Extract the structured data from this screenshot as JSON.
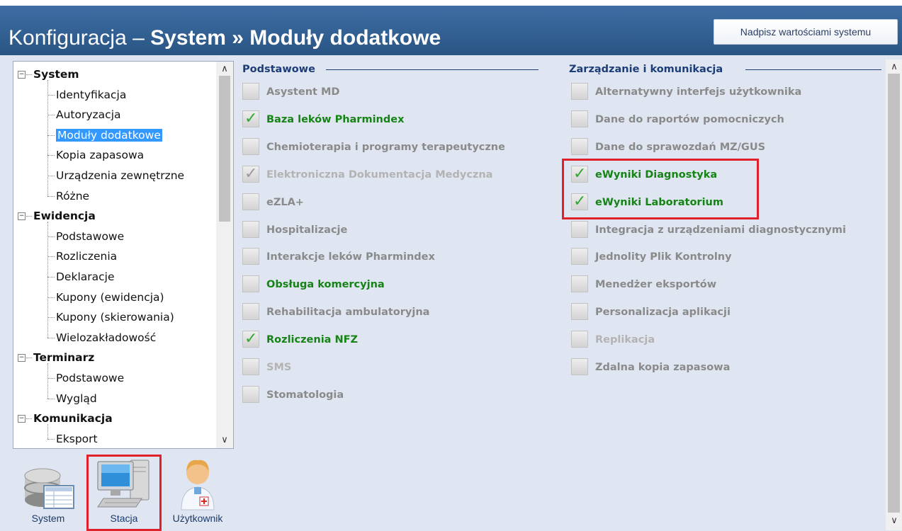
{
  "header": {
    "title_prefix": "Konfiguracja – ",
    "title_bold": "System » Moduły dodatkowe",
    "overwrite_button": "Nadpisz wartościami systemu"
  },
  "tree": {
    "groups": [
      {
        "label": "System",
        "items": [
          "Identyfikacja",
          "Autoryzacja",
          "Moduły dodatkowe",
          "Kopia zapasowa",
          "Urządzenia zewnętrzne",
          "Różne"
        ]
      },
      {
        "label": "Ewidencja",
        "items": [
          "Podstawowe",
          "Rozliczenia",
          "Deklaracje",
          "Kupony (ewidencja)",
          "Kupony (skierowania)",
          "Wielozakładowość"
        ]
      },
      {
        "label": "Terminarz",
        "items": [
          "Podstawowe",
          "Wygląd"
        ]
      },
      {
        "label": "Komunikacja",
        "items": [
          "Eksport"
        ]
      }
    ],
    "selected": "Moduły dodatkowe",
    "expander_symbol": "−",
    "scroll_up": "∧",
    "scroll_down": "∨"
  },
  "nav": {
    "system": "System",
    "stacja": "Stacja",
    "uzytkownik": "Użytkownik",
    "active": "Stacja"
  },
  "sections": {
    "basic": {
      "title": "Podstawowe",
      "items": [
        {
          "label": "Asystent MD",
          "state": "off"
        },
        {
          "label": "Baza leków Pharmindex",
          "state": "on"
        },
        {
          "label": "Chemioterapia i programy terapeutyczne",
          "state": "off"
        },
        {
          "label": "Elektroniczna Dokumentacja Medyczna",
          "state": "disabled-checked"
        },
        {
          "label": "eZLA+",
          "state": "off"
        },
        {
          "label": "Hospitalizacje",
          "state": "off"
        },
        {
          "label": "Interakcje leków Pharmindex",
          "state": "off"
        },
        {
          "label": "Obsługa komercyjna",
          "state": "on-unchecked"
        },
        {
          "label": "Rehabilitacja ambulatoryjna",
          "state": "off"
        },
        {
          "label": "Rozliczenia NFZ",
          "state": "on"
        },
        {
          "label": "SMS",
          "state": "disabled"
        },
        {
          "label": "Stomatologia",
          "state": "off"
        }
      ]
    },
    "management": {
      "title": "Zarządzanie i komunikacja",
      "items": [
        {
          "label": "Alternatywny interfejs użytkownika",
          "state": "off"
        },
        {
          "label": "Dane do raportów pomocniczych",
          "state": "off"
        },
        {
          "label": "Dane do sprawozdań MZ/GUS",
          "state": "off"
        },
        {
          "label": "eWyniki Diagnostyka",
          "state": "on"
        },
        {
          "label": "eWyniki Laboratorium",
          "state": "on"
        },
        {
          "label": "Integracja z urządzeniami diagnostycznymi",
          "state": "off"
        },
        {
          "label": "Jednolity Plik Kontrolny",
          "state": "off"
        },
        {
          "label": "Menedżer eksportów",
          "state": "off"
        },
        {
          "label": "Personalizacja aplikacji",
          "state": "off"
        },
        {
          "label": "Replikacja",
          "state": "disabled"
        },
        {
          "label": "Zdalna kopia zapasowa",
          "state": "off"
        }
      ]
    }
  },
  "checkmark_glyph": "✓",
  "colors": {
    "header_bg": "#2f5f94",
    "checked_text": "#168316",
    "unchecked_text": "#8a8a8a",
    "disabled_text": "#b3b3b3",
    "highlight": "#e0202b"
  }
}
